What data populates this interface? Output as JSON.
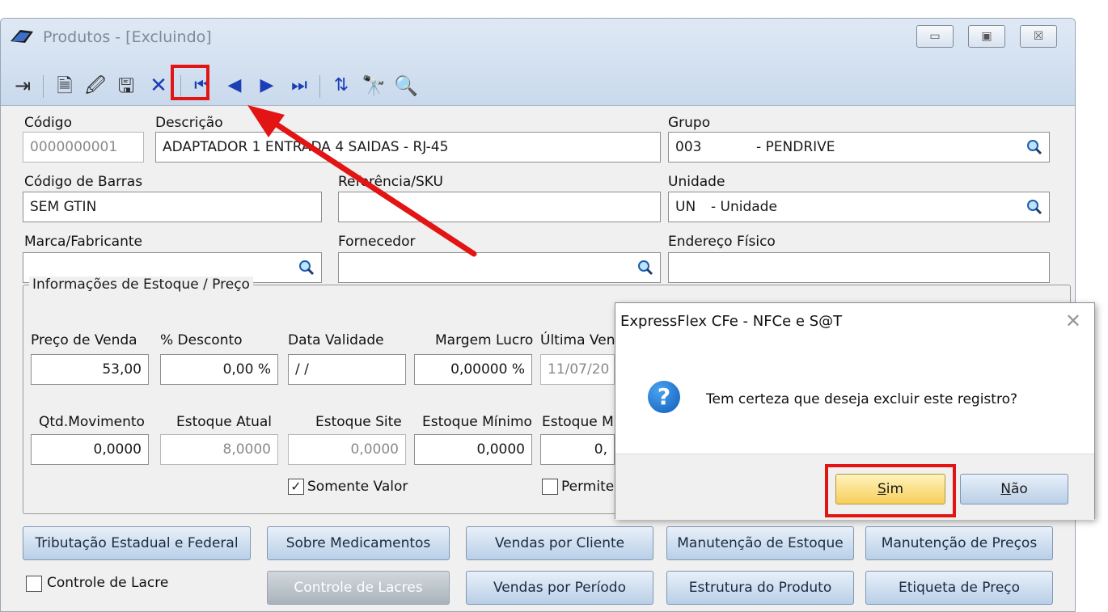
{
  "window": {
    "title": "Produtos - [Excluindo]",
    "controls": {
      "minimize": "▭",
      "maximize": "▣",
      "close": "☒"
    }
  },
  "toolbar": {
    "buttons": [
      {
        "name": "exit-icon",
        "glyph": "⇥"
      },
      {
        "name": "new-record-icon",
        "glyph": "🗎"
      },
      {
        "name": "edit-record-icon",
        "glyph": "🖉"
      },
      {
        "name": "save-icon",
        "glyph": "🖫"
      },
      {
        "name": "delete-icon",
        "glyph": "✕"
      },
      {
        "name": "first-record-icon",
        "glyph": "⏮"
      },
      {
        "name": "previous-record-icon",
        "glyph": "◀"
      },
      {
        "name": "next-record-icon",
        "glyph": "▶"
      },
      {
        "name": "last-record-icon",
        "glyph": "⏭"
      },
      {
        "name": "sort-icon",
        "glyph": "⇅"
      },
      {
        "name": "find-icon",
        "glyph": "🔭"
      },
      {
        "name": "search-icon",
        "glyph": "🔍"
      }
    ]
  },
  "form": {
    "codigo": {
      "label": "Código",
      "value": "0000000001"
    },
    "descricao": {
      "label": "Descrição",
      "value": "ADAPTADOR 1 ENTRADA 4 SAIDAS - RJ-45"
    },
    "grupo": {
      "label": "Grupo",
      "code": "003",
      "name": "- PENDRIVE"
    },
    "codigo_barras": {
      "label": "Código de Barras",
      "value": "SEM GTIN"
    },
    "referencia": {
      "label": "Referência/SKU",
      "value": ""
    },
    "unidade": {
      "label": "Unidade",
      "code": "UN",
      "name": "- Unidade"
    },
    "marca": {
      "label": "Marca/Fabricante",
      "value": ""
    },
    "fornecedor": {
      "label": "Fornecedor",
      "value": ""
    },
    "endereco": {
      "label": "Endereço Físico",
      "value": ""
    }
  },
  "stock": {
    "group_title": "Informações de Estoque / Preço",
    "preco_venda": {
      "label": "Preço de Venda",
      "value": "53,00"
    },
    "desconto": {
      "label": "% Desconto",
      "value": "0,00 %"
    },
    "data_validade": {
      "label": "Data Validade",
      "value": "/ /"
    },
    "margem_lucro": {
      "label": "Margem Lucro",
      "value": "0,00000 %"
    },
    "ultima_venda": {
      "label": "Última Ven",
      "value": "11/07/20"
    },
    "qtd_movimento": {
      "label": "Qtd.Movimento",
      "value": "0,0000"
    },
    "estoque_atual": {
      "label": "Estoque Atual",
      "value": "8,0000"
    },
    "estoque_site": {
      "label": "Estoque Site",
      "value": "0,0000"
    },
    "estoque_minimo": {
      "label": "Estoque Mínimo",
      "value": "0,0000"
    },
    "estoque_max": {
      "label": "Estoque M",
      "value": "0,"
    },
    "somente_valor": {
      "label": "Somente Valor",
      "checked": true,
      "glyph": "✓"
    },
    "permite": {
      "label": "Permite",
      "checked": false
    }
  },
  "buttons": {
    "row1": [
      "Tributação Estadual e Federal",
      "Sobre Medicamentos",
      "Vendas por Cliente",
      "Manutenção de Estoque",
      "Manutenção de Preços"
    ],
    "row2": [
      "Controle de Lacres",
      "Vendas por Período",
      "Estrutura do Produto",
      "Etiqueta de Preço"
    ],
    "controle_lacre": "Controle de Lacre"
  },
  "dialog": {
    "title": "ExpressFlex CFe - NFCe e S@T",
    "close": "✕",
    "icon": "?",
    "message": "Tem certeza que deseja excluir este registro?",
    "yes_key": "S",
    "yes_rest": "im",
    "no_key": "N",
    "no_rest": "ão"
  },
  "colors": {
    "highlight": "#e31414",
    "dialog_yes": "#f7cf5a",
    "button_blue": "#b9cfe7"
  }
}
